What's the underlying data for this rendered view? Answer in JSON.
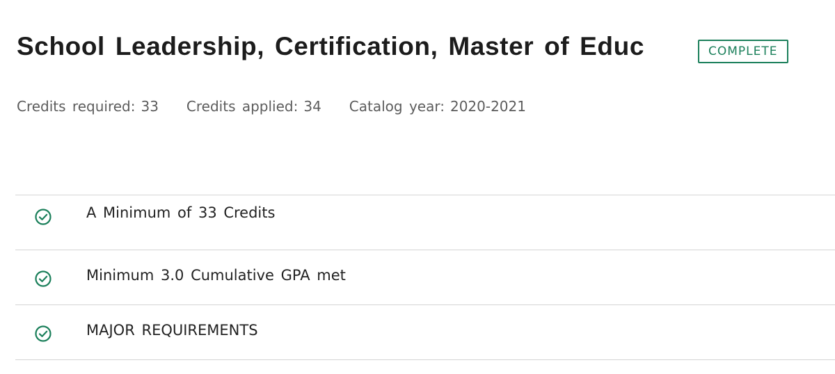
{
  "program": {
    "title": "School Leadership, Certification, Master of Educ",
    "status": "COMPLETE"
  },
  "meta": {
    "credits_required_label": "Credits required:",
    "credits_required_value": "33",
    "credits_applied_label": "Credits applied:",
    "credits_applied_value": "34",
    "catalog_year_label": "Catalog year:",
    "catalog_year_value": "2020-2021"
  },
  "requirements": [
    {
      "label": "A Minimum of 33 Credits",
      "icon": "check-circle-icon",
      "status": "complete"
    },
    {
      "label": "Minimum 3.0 Cumulative GPA met",
      "icon": "check-circle-icon",
      "status": "complete"
    },
    {
      "label": "MAJOR REQUIREMENTS",
      "icon": "check-circle-icon",
      "status": "complete"
    }
  ],
  "colors": {
    "accent": "#1a7f5a",
    "text": "#222222",
    "muted": "#5c5c5c",
    "divider": "#d4d4d4"
  }
}
